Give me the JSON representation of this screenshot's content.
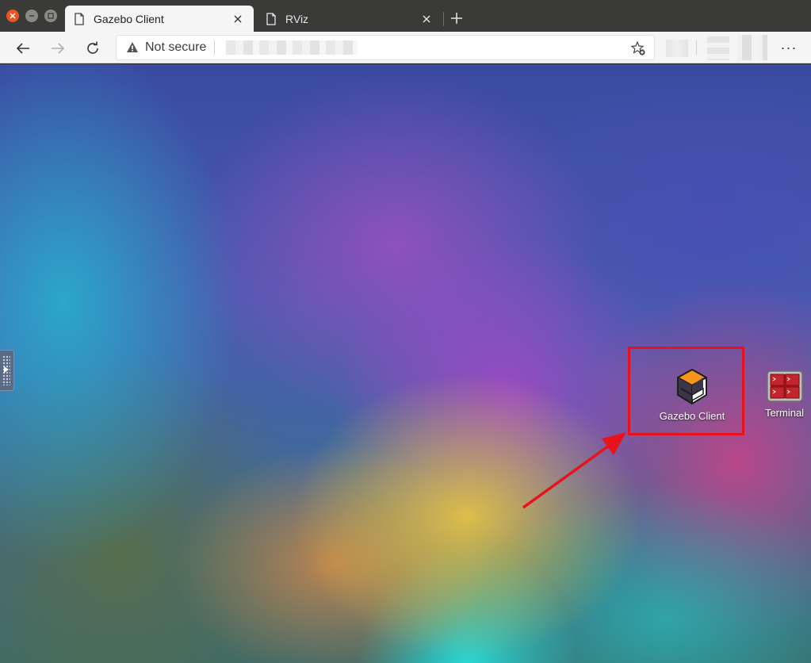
{
  "window": {
    "controls": [
      "close",
      "minimize",
      "maximize"
    ]
  },
  "tabs": [
    {
      "title": "Gazebo Client",
      "active": true,
      "icon": "page-icon"
    },
    {
      "title": "RViz",
      "active": false,
      "icon": "page-icon"
    }
  ],
  "toolbar": {
    "security_label": "Not secure",
    "url": "",
    "menu_label": "···"
  },
  "desktop": {
    "icons": [
      {
        "label": "Gazebo Client",
        "icon": "gazebo-icon"
      },
      {
        "label": "Terminal",
        "icon": "terminal-icon"
      }
    ],
    "annotation_color": "#e8121c"
  },
  "colors": {
    "tabstrip": "#3a3a38",
    "toolbar": "#f5f5f5",
    "close_button": "#e95420",
    "gazebo_orange": "#f7941d"
  }
}
